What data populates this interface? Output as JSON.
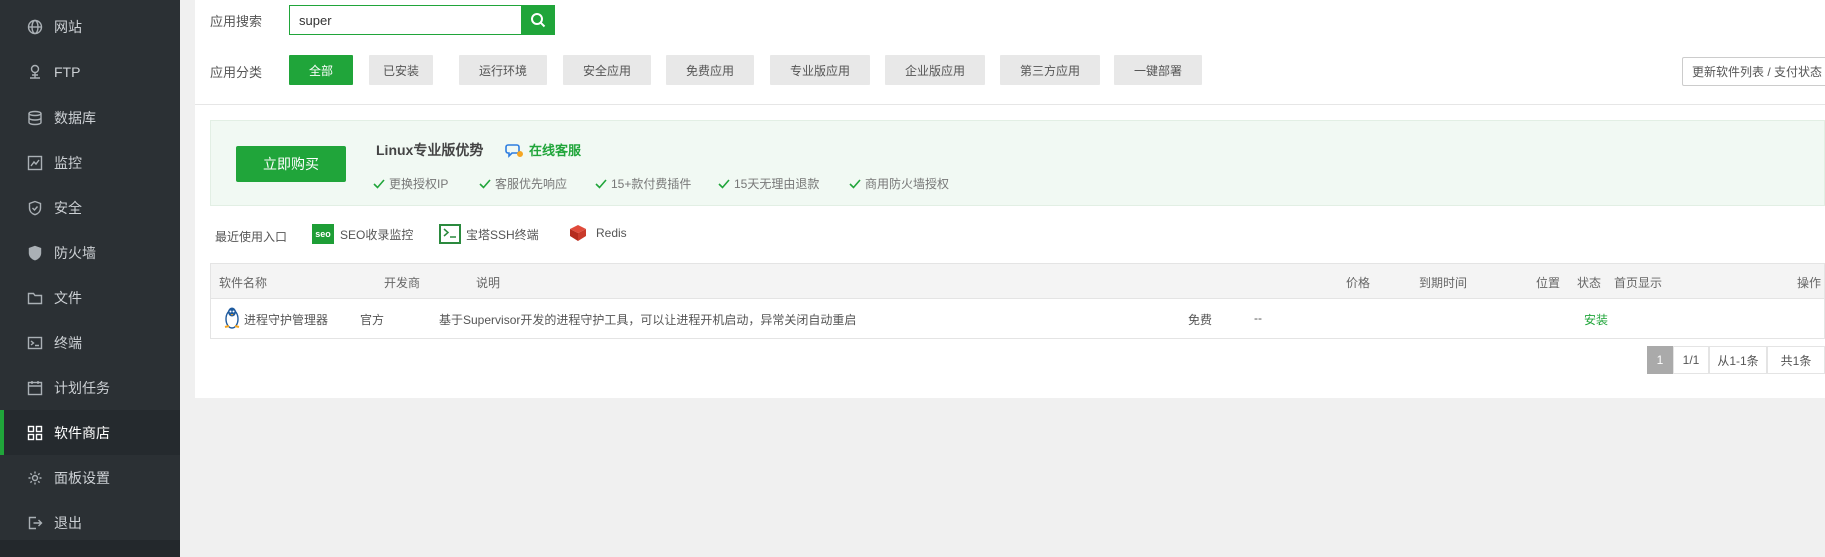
{
  "sidebar": {
    "items": [
      {
        "label": "网站",
        "icon": "globe-icon"
      },
      {
        "label": "FTP",
        "icon": "ftp-icon"
      },
      {
        "label": "数据库",
        "icon": "database-icon"
      },
      {
        "label": "监控",
        "icon": "monitor-icon"
      },
      {
        "label": "安全",
        "icon": "shield-icon"
      },
      {
        "label": "防火墙",
        "icon": "firewall-icon"
      },
      {
        "label": "文件",
        "icon": "folder-icon"
      },
      {
        "label": "终端",
        "icon": "terminal-icon"
      },
      {
        "label": "计划任务",
        "icon": "calendar-icon"
      },
      {
        "label": "软件商店",
        "icon": "grid-icon"
      },
      {
        "label": "面板设置",
        "icon": "gear-icon"
      },
      {
        "label": "退出",
        "icon": "logout-icon"
      }
    ],
    "active_index": 9
  },
  "search": {
    "label": "应用搜索",
    "value": "super"
  },
  "categories": {
    "label": "应用分类",
    "items": [
      "全部",
      "已安装",
      "运行环境",
      "安全应用",
      "免费应用",
      "专业版应用",
      "企业版应用",
      "第三方应用",
      "一键部署"
    ],
    "active_index": 0
  },
  "update_button": "更新软件列表 / 支付状态",
  "promo": {
    "buy_label": "立即购买",
    "title": "Linux专业版优势",
    "service": "在线客服",
    "features": [
      "更换授权IP",
      "客服优先响应",
      "15+款付费插件",
      "15天无理由退款",
      "商用防火墙授权"
    ]
  },
  "recent": {
    "label": "最近使用入口",
    "items": [
      {
        "name": "SEO收录监控",
        "icon_text": "seo"
      },
      {
        "name": "宝塔SSH终端"
      },
      {
        "name": "Redis"
      }
    ]
  },
  "table": {
    "headers": [
      "软件名称",
      "开发商",
      "说明",
      "价格",
      "到期时间",
      "位置",
      "状态",
      "首页显示",
      "操作"
    ],
    "rows": [
      {
        "name": "进程守护管理器",
        "developer": "官方",
        "description": "基于Supervisor开发的进程守护工具，可以让进程开机启动，异常关闭自动重启",
        "price": "免费",
        "expiry": "--",
        "action": "安装"
      }
    ]
  },
  "pagination": {
    "current": "1",
    "pages": "1/1",
    "range": "从1-1条",
    "total": "共1条"
  },
  "colors": {
    "accent": "#20a53a",
    "sidebar_bg": "#2b3034"
  }
}
